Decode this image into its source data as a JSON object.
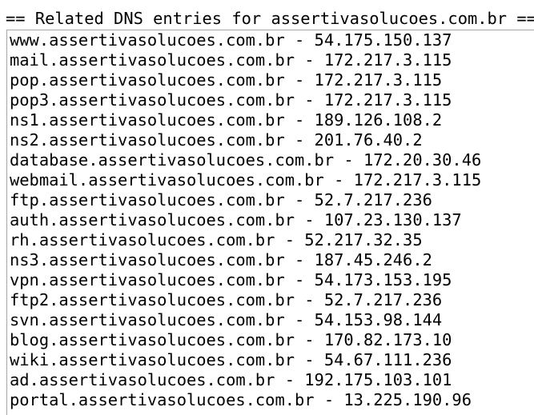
{
  "heading": "== Related DNS entries for assertivasolucoes.com.br ==",
  "entries": [
    "www.assertivasolucoes.com.br - 54.175.150.137",
    "mail.assertivasolucoes.com.br - 172.217.3.115",
    "pop.assertivasolucoes.com.br - 172.217.3.115",
    "pop3.assertivasolucoes.com.br - 172.217.3.115",
    "ns1.assertivasolucoes.com.br - 189.126.108.2",
    "ns2.assertivasolucoes.com.br - 201.76.40.2",
    "database.assertivasolucoes.com.br - 172.20.30.46",
    "webmail.assertivasolucoes.com.br - 172.217.3.115",
    "ftp.assertivasolucoes.com.br - 52.7.217.236",
    "auth.assertivasolucoes.com.br - 107.23.130.137",
    "rh.assertivasolucoes.com.br - 52.217.32.35",
    "ns3.assertivasolucoes.com.br - 187.45.246.2",
    "vpn.assertivasolucoes.com.br - 54.173.153.195",
    "ftp2.assertivasolucoes.com.br - 52.7.217.236",
    "svn.assertivasolucoes.com.br - 54.153.98.144",
    "blog.assertivasolucoes.com.br - 170.82.173.10",
    "wiki.assertivasolucoes.com.br - 54.67.111.236",
    "ad.assertivasolucoes.com.br - 192.175.103.101",
    "portal.assertivasolucoes.com.br - 13.225.190.96"
  ]
}
